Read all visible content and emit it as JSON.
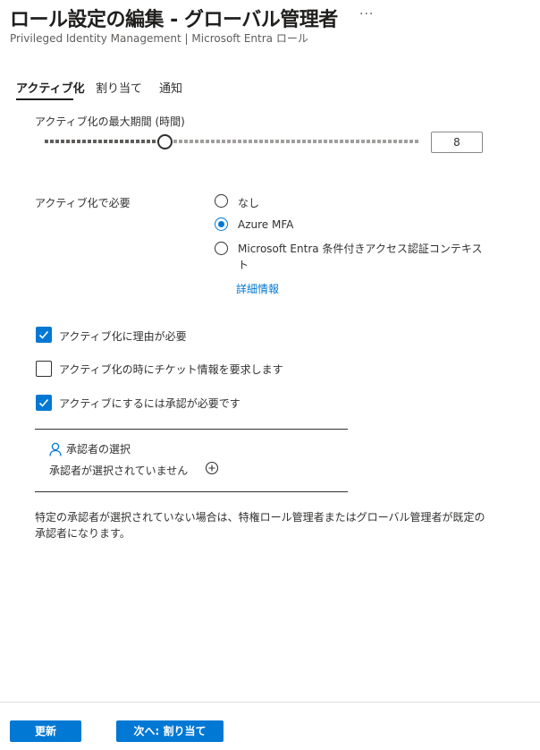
{
  "header": {
    "title": "ロール設定の編集 - グローバル管理者",
    "more": "···",
    "subtitle": "Privileged Identity Management | Microsoft Entra ロール"
  },
  "tabs": [
    {
      "label": "アクティブ化",
      "active": true
    },
    {
      "label": "割り当て",
      "active": false
    },
    {
      "label": "通知",
      "active": false
    }
  ],
  "max_duration": {
    "label": "アクティブ化の最大期間 (時間)",
    "value": "8",
    "slider_fraction": 0.32
  },
  "require_on_activation": {
    "label": "アクティブ化で必要",
    "options": [
      {
        "label": "なし",
        "selected": false
      },
      {
        "label": "Azure MFA",
        "selected": true
      },
      {
        "label": "Microsoft Entra 条件付きアクセス認証コンテキスト",
        "selected": false
      }
    ],
    "more_info": "詳細情報"
  },
  "checkboxes": [
    {
      "label": "アクティブ化に理由が必要",
      "checked": true
    },
    {
      "label": "アクティブ化の時にチケット情報を要求します",
      "checked": false
    },
    {
      "label": "アクティブにするには承認が必要です",
      "checked": true
    }
  ],
  "approvers": {
    "heading": "承認者の選択",
    "status": "承認者が選択されていません"
  },
  "note": "特定の承認者が選択されていない場合は、特権ロール管理者またはグローバル管理者が既定の承認者になります。",
  "footer": {
    "update_label": "更新",
    "next_label": "次へ: 割り当て"
  },
  "colors": {
    "accent": "#0078d4"
  }
}
